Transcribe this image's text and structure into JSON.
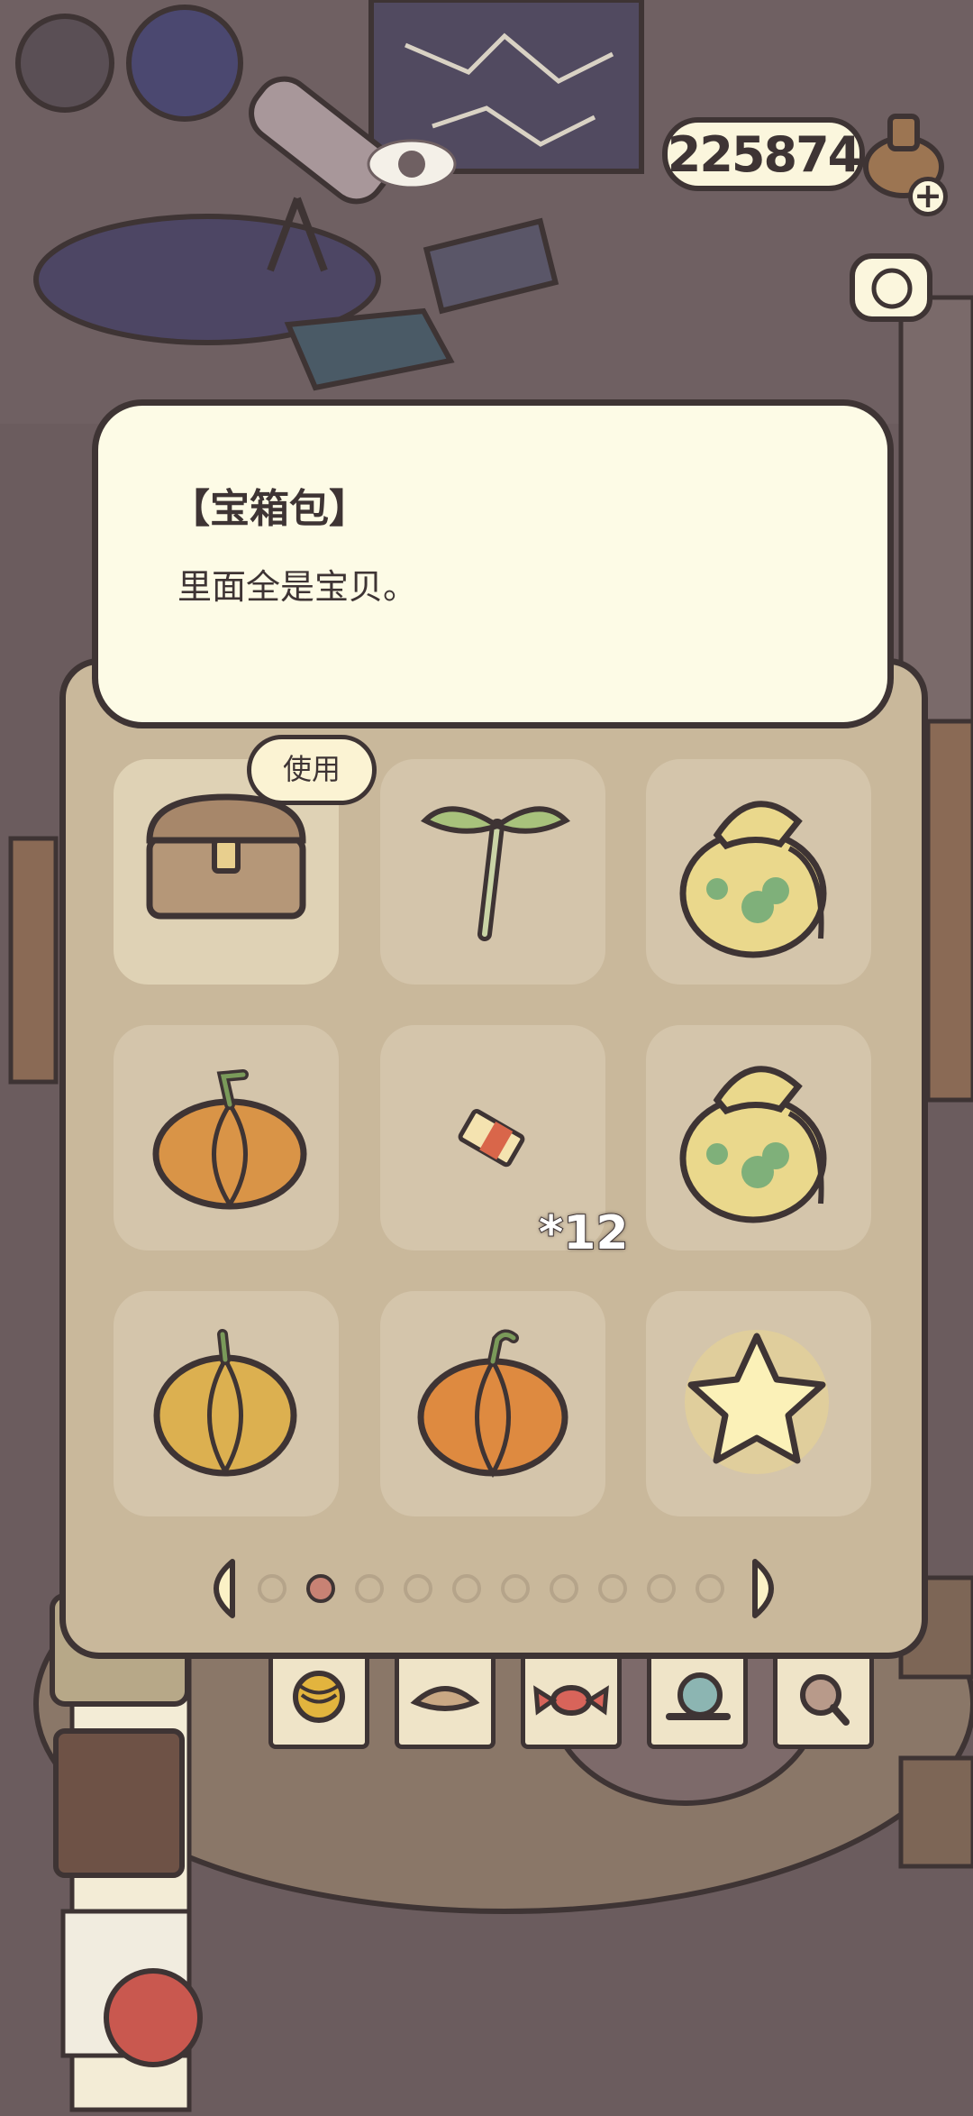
{
  "currency": {
    "amount": "225874",
    "plus_icon": "plus-icon",
    "coin_icon": "acorn-coin-icon"
  },
  "item_detail": {
    "title": "【宝箱包】",
    "description": "里面全是宝贝。"
  },
  "inventory": {
    "use_label": "使用",
    "slots": [
      {
        "icon": "treasure-chest-icon",
        "selected": true
      },
      {
        "icon": "sprout-icon"
      },
      {
        "icon": "clover-bag-icon"
      },
      {
        "icon": "pumpkin-icon"
      },
      {
        "icon": "ticket-icon",
        "count": "*12"
      },
      {
        "icon": "clover-bag-icon"
      },
      {
        "icon": "yellow-pumpkin-icon"
      },
      {
        "icon": "orange-pumpkin-icon"
      },
      {
        "icon": "glowing-star-icon"
      }
    ],
    "pagination": {
      "total_pages": 10,
      "current_page": 2
    }
  },
  "tabs": [
    "yarn-ball-icon",
    "leaf-icon",
    "candy-icon",
    "snail-icon",
    "magnifier-icon"
  ],
  "colors": {
    "outline": "#3e3434",
    "card": "#fdfbe6",
    "panel": "#c9b89b",
    "background": "#6b5c5e"
  }
}
